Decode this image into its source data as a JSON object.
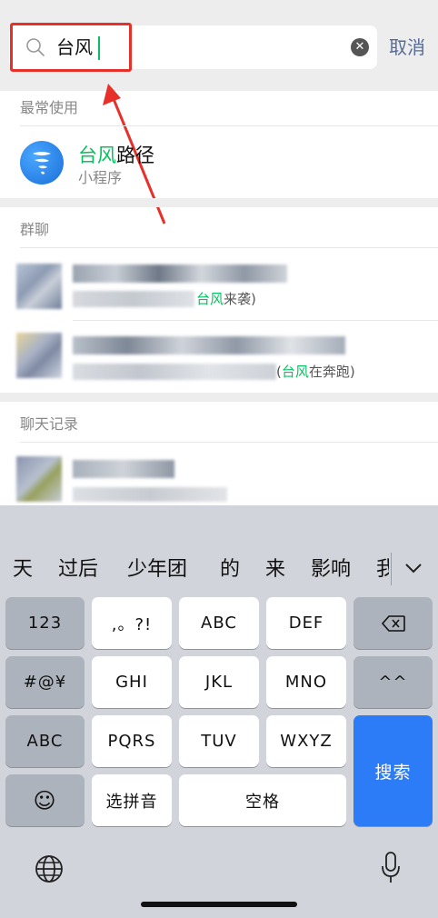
{
  "search": {
    "query": "台风",
    "cancel_label": "取消",
    "clear_icon": "clear-icon",
    "search_icon": "search-icon"
  },
  "sections": {
    "recent": {
      "title": "最常使用",
      "item": {
        "name_highlight": "台风",
        "name_rest": "路径",
        "type": "小程序",
        "icon": "typhoon-app-icon"
      }
    },
    "groups": {
      "title": "群聊",
      "rows": [
        {
          "suffix_highlight": "台风",
          "suffix_rest": "来袭)"
        },
        {
          "suffix_prefix": "(",
          "suffix_highlight": "台风",
          "suffix_rest": "在奔跑)"
        }
      ]
    },
    "chat_history": {
      "title": "聊天记录"
    }
  },
  "keyboard": {
    "candidates": [
      "天",
      "过后",
      "少年团",
      "的",
      "来",
      "影响",
      "我"
    ],
    "rows": [
      [
        "123",
        ",。?!",
        "ABC",
        "DEF",
        "⌫"
      ],
      [
        "#@¥",
        "GHI",
        "JKL",
        "MNO",
        "^^"
      ],
      [
        "ABC",
        "PQRS",
        "TUV",
        "WXYZ"
      ],
      [
        "☺",
        "选拼音",
        "空格"
      ]
    ],
    "search_label": "搜索",
    "globe_icon": "globe-icon",
    "mic_icon": "microphone-icon"
  },
  "colors": {
    "highlight_green": "#07c160",
    "link_blue": "#576b95",
    "annotation_red": "#e8302a",
    "key_blue": "#2b7cf6"
  }
}
